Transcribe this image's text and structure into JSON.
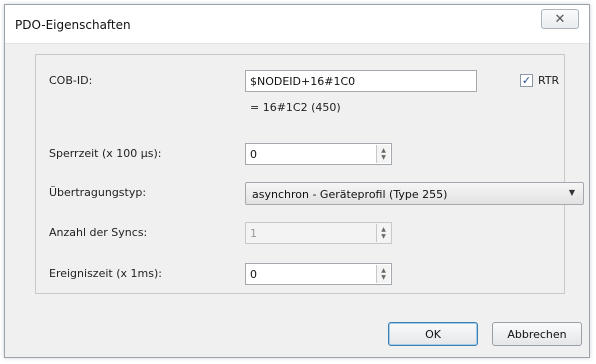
{
  "window": {
    "title": "PDO-Eigenschaften",
    "close_icon": "close-icon"
  },
  "form": {
    "cob_id": {
      "label": "COB-ID:",
      "value": "$NODEID+16#1C0",
      "resolved": "= 16#1C2 (450)"
    },
    "rtr": {
      "label": "RTR",
      "checked": true
    },
    "inhibit_time": {
      "label": "Sperrzeit (x 100 µs):",
      "value": "0"
    },
    "transmission_type": {
      "label": "Übertragungstyp:",
      "value": "asynchron - Geräteprofil (Type 255)"
    },
    "sync_count": {
      "label": "Anzahl der Syncs:",
      "value": "1",
      "disabled": true
    },
    "event_time": {
      "label": "Ereigniszeit (x 1ms):",
      "value": "0"
    }
  },
  "buttons": {
    "ok": "OK",
    "cancel": "Abbrechen"
  }
}
